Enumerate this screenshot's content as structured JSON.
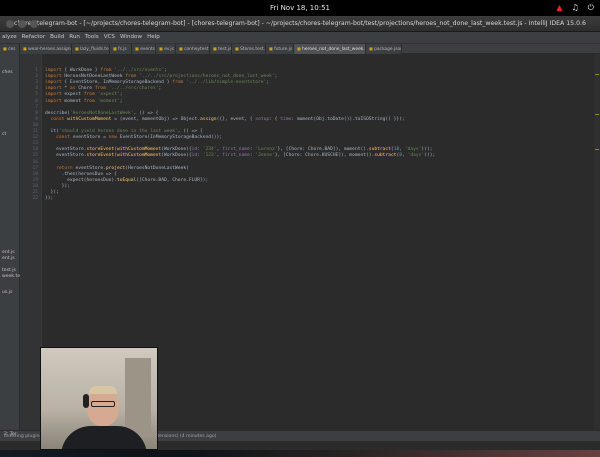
{
  "system": {
    "clock": "Fri Nov 18, 10:51",
    "tray_icons": [
      "network-icon",
      "volume-icon",
      "power-icon"
    ]
  },
  "window": {
    "title": "chores-telegram-bot - [~/projects/chores-telegram-bot] - [chores-telegram-bot] - ~/projects/chores-telegram-bot/test/projections/heroes_not_done_last_week.test.js - IntelliJ IDEA 15.0.6"
  },
  "menu": [
    "alyze",
    "Refactor",
    "Build",
    "Run",
    "Tools",
    "VCS",
    "Window",
    "Help"
  ],
  "breadcrumb": [
    "projections",
    "heroes_not_done_last_week.test.js"
  ],
  "tabs": [
    "ces",
    "wear-heroes.assignments.test.js",
    "lazy_fluids.test.js",
    "fs.js",
    "events.js",
    "ev.js",
    "conheytest.js",
    "test.js",
    "Stores.test.js",
    "future.js",
    "heroes_not_done_last_week.test.js",
    "package.json"
  ],
  "active_tab_index": 10,
  "project_panel": [
    "ches",
    "ct",
    "ent.js",
    "ent.js",
    "test.js",
    "week.test.js",
    "us.js"
  ],
  "code": {
    "lines": [
      {
        "n": "1",
        "text": "import { WorkDone } from '../../src/events';"
      },
      {
        "n": "2",
        "text": "import HeroesNotDoneLastWeek from '../../src/projections/heroes_not_done_last_week';"
      },
      {
        "n": "3",
        "text": "import { EventStore, InMemoryStorageBackend } from '../../lib/simple-eventstore';"
      },
      {
        "n": "4",
        "text": "import * as Chore from '../../src/chores';"
      },
      {
        "n": "5",
        "text": "import expect from 'expect';"
      },
      {
        "n": "6",
        "text": "import moment from 'moment';"
      },
      {
        "n": "7",
        "text": ""
      },
      {
        "n": "8",
        "text": "describe('HeroesNotDoneLastWeek', () => {"
      },
      {
        "n": "9",
        "text": "  const withCustomMoment = (event, momentObj) => Object.assign({}, event, { setup: { time: moment(Obj.toDate()).toISOString() }});"
      },
      {
        "n": "10",
        "text": ""
      },
      {
        "n": "11",
        "text": "  it('should yield heroes done in the last week', () => {"
      },
      {
        "n": "12",
        "text": "    const eventStore = new EventStore(InMemoryStorageBackend());"
      },
      {
        "n": "13",
        "text": ""
      },
      {
        "n": "14",
        "text": "    eventStore.storeEvent(withCustomMoment(WorkDone({id: '234', first_name: 'Lorenz'}, [Chore: Chore.BAD]), moment().subtract(10, 'days')));"
      },
      {
        "n": "15",
        "text": "    eventStore.storeEvent(withCustomMoment(WorkDone({id: '123', first_name: 'Jonne'}, [Chore: Chore.KUSCHE]), moment().subtract(8, 'days')));"
      },
      {
        "n": "16",
        "text": ""
      },
      {
        "n": "17",
        "text": "    return eventStore.project(HeroesNotDoneLastWeek)"
      },
      {
        "n": "18",
        "text": "      .then(heroesDue => {"
      },
      {
        "n": "19",
        "text": "        expect(heroesDue).toEqual([Chore.BAD, Chore.FLUR]);"
      },
      {
        "n": "20",
        "text": "      });"
      },
      {
        "n": "21",
        "text": "  });"
      },
      {
        "n": "22",
        "text": "});"
      }
    ]
  },
  "status_bar": "Indexing plugins missing (to update changelogs, recommended extensions) (4 minutes ago)",
  "bottom_tool": "2: Ter",
  "colors": {
    "keyword": "#cc7832",
    "string": "#6a8759",
    "function": "#ffc66d",
    "number": "#6897bb",
    "identifier": "#a9b7c6",
    "purple": "#9876aa"
  }
}
